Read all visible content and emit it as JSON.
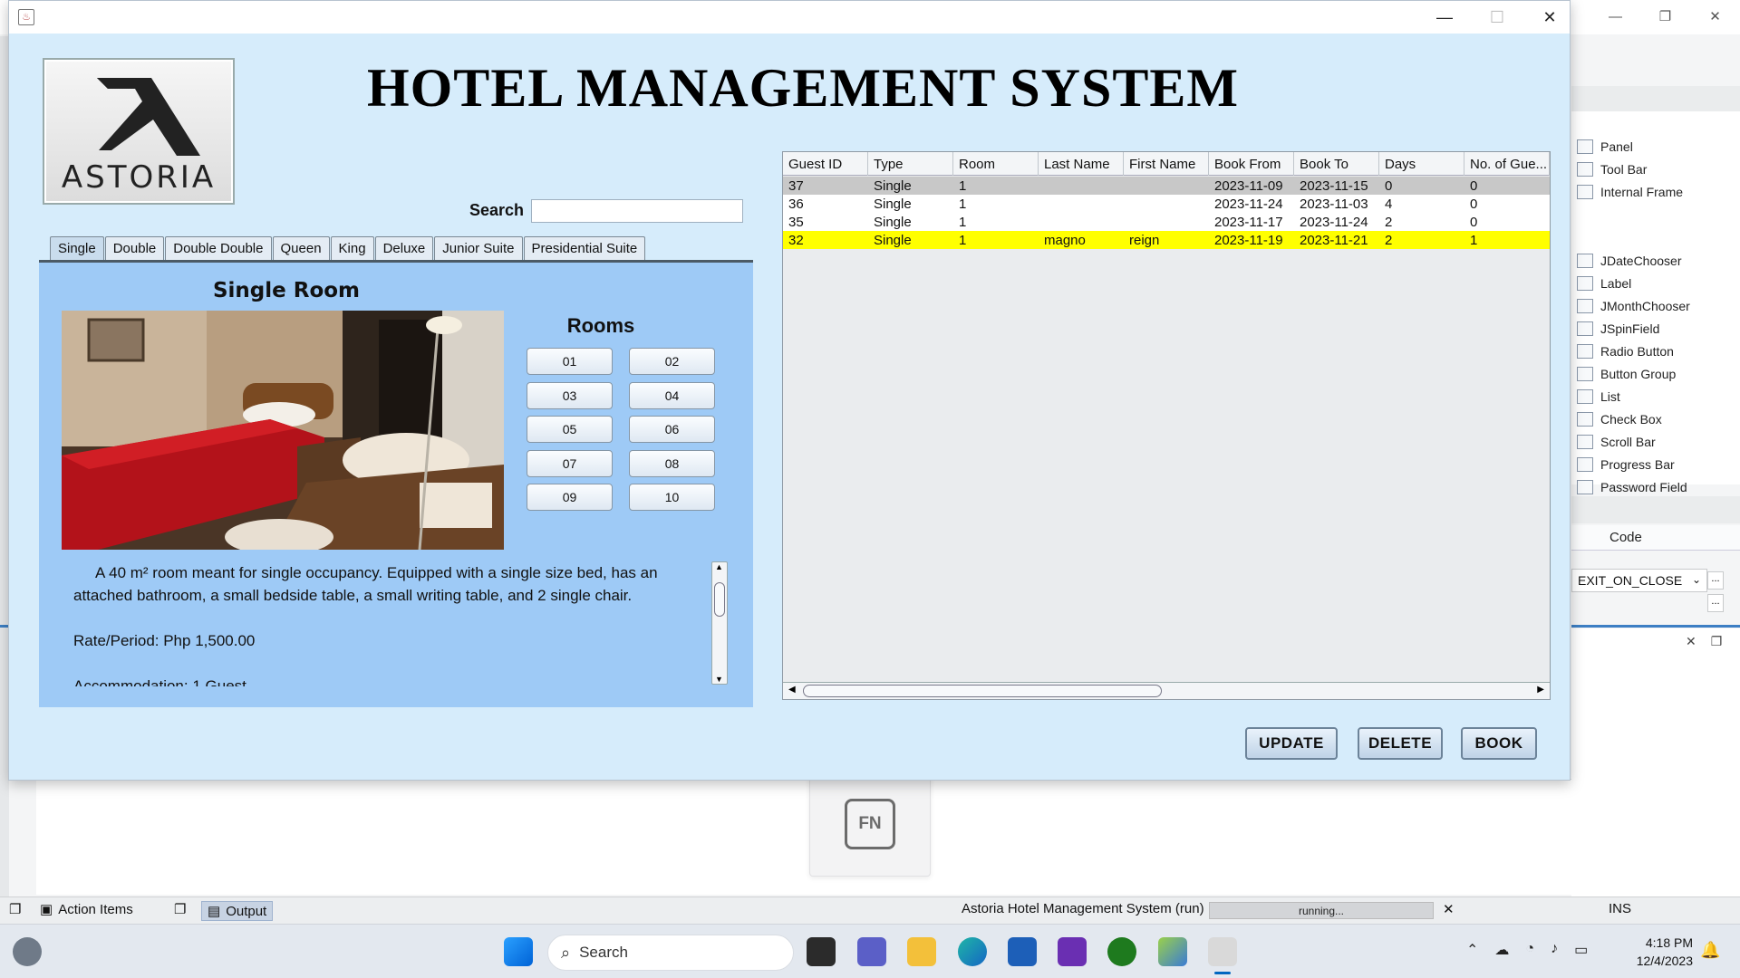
{
  "window": {
    "title_icon": "java-icon",
    "controls": [
      "minimize-icon",
      "maximize-icon",
      "close-icon"
    ]
  },
  "app": {
    "title": "HOTEL MANAGEMENT SYSTEM",
    "logo_text": "ASTORIA",
    "search_label": "Search",
    "search_value": "",
    "tabs": [
      "Single",
      "Double",
      "Double Double",
      "Queen",
      "King",
      "Deluxe",
      "Junior Suite",
      "Presidential Suite"
    ],
    "active_tab": "Single",
    "room_title": "Single Room",
    "rooms_label": "Rooms",
    "room_buttons": [
      "01",
      "02",
      "03",
      "04",
      "05",
      "06",
      "07",
      "08",
      "09",
      "10"
    ],
    "description": "A 40 m² room meant for single occupancy. Equipped with a single size bed, has an attached bathroom, a small bedside table, a small writing table, and 2 single chair.",
    "rate": "Rate/Period: Php 1,500.00",
    "accommodation": "Accommodation: 1 Guest",
    "actions": {
      "update": "UPDATE",
      "delete": "DELETE",
      "book": "BOOK"
    }
  },
  "table": {
    "columns": [
      "Guest ID",
      "Type",
      "Room",
      "Last Name",
      "First Name",
      "Book From",
      "Book To",
      "Days",
      "No. of Gue..."
    ],
    "rows": [
      [
        "37",
        "Single",
        "1",
        "",
        "",
        "2023-11-09",
        "2023-11-15",
        "0",
        "0"
      ],
      [
        "36",
        "Single",
        "1",
        "",
        "",
        "2023-11-24",
        "2023-11-03",
        "4",
        "0"
      ],
      [
        "35",
        "Single",
        "1",
        "",
        "",
        "2023-11-17",
        "2023-11-24",
        "2",
        "0"
      ],
      [
        "32",
        "Single",
        "1",
        "magno",
        "reign",
        "2023-11-19",
        "2023-11-21",
        "2",
        "1"
      ]
    ],
    "row_states": [
      "selected",
      "normal",
      "normal",
      "highlighted"
    ],
    "colors": {
      "selected": "#c8c8c8",
      "highlighted": "#ffff00"
    }
  },
  "ide": {
    "palette": [
      "Panel",
      "Tool Bar",
      "Internal Frame",
      "JDateChooser",
      "Label",
      "JMonthChooser",
      "JSpinField",
      "Radio Button",
      "Button Group",
      "List",
      "Check Box",
      "Scroll Bar",
      "Progress Bar",
      "Password Field"
    ],
    "code_tab": "Code",
    "close_operation": "EXIT_ON_CLOSE",
    "dots": "..."
  },
  "statusbar": {
    "action_items": "Action Items",
    "output": "Output",
    "run_label": "Astoria Hotel Management System (run)",
    "progress_text": "running...",
    "ins": "INS"
  },
  "fn_key": "FN",
  "taskbar": {
    "search_placeholder": "Search",
    "time": "4:18 PM",
    "date": "12/4/2023"
  }
}
